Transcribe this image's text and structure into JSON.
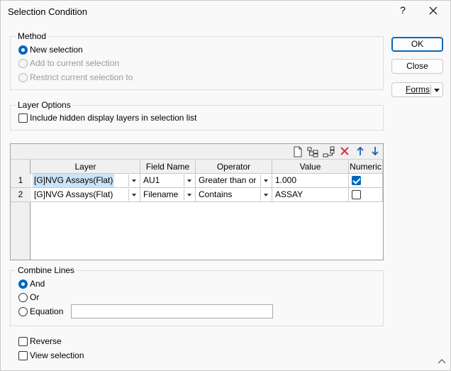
{
  "window": {
    "title": "Selection Condition",
    "help_label": "?"
  },
  "method": {
    "label": "Method",
    "options": [
      {
        "label": "New selection",
        "checked": true,
        "enabled": true
      },
      {
        "label": "Add to current selection",
        "checked": false,
        "enabled": false
      },
      {
        "label": "Restrict current selection to",
        "checked": false,
        "enabled": false
      }
    ]
  },
  "layer_options": {
    "label": "Layer Options",
    "include_hidden_label": "Include hidden display layers in selection list",
    "include_hidden_checked": false
  },
  "buttons": {
    "ok": "OK",
    "close": "Close",
    "forms": "Forms"
  },
  "grid": {
    "columns": [
      "Layer",
      "Field Name",
      "Operator",
      "Value",
      "Numeric"
    ],
    "rows": [
      {
        "num": "1",
        "layer": "[G]NVG Assays(Flat)",
        "field": "AU1",
        "operator": "Greater than or",
        "value": "1.000",
        "numeric": true
      },
      {
        "num": "2",
        "layer": "[G]NVG Assays(Flat)",
        "field": "Filename",
        "operator": "Contains",
        "value": "ASSAY",
        "numeric": false
      }
    ],
    "toolbar_icons": [
      "new-row-icon",
      "insert-row-icon",
      "append-row-icon",
      "delete-icon",
      "move-up-icon",
      "move-down-icon"
    ]
  },
  "combine": {
    "label": "Combine Lines",
    "options": [
      {
        "label": "And",
        "checked": true
      },
      {
        "label": "Or",
        "checked": false
      },
      {
        "label": "Equation",
        "checked": false
      }
    ],
    "equation_value": ""
  },
  "reverse": {
    "label": "Reverse",
    "checked": false
  },
  "view_selection": {
    "label": "View selection",
    "checked": false
  },
  "colors": {
    "accent": "#0067c0",
    "delete": "#d13438",
    "arrow": "#1a5fb4"
  }
}
